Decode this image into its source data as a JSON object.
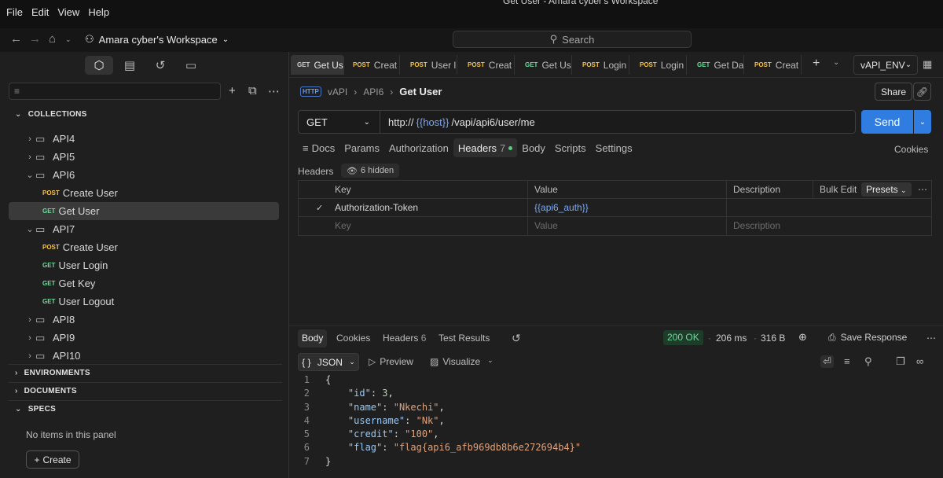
{
  "menu": [
    "File",
    "Edit",
    "View",
    "Help"
  ],
  "window_title": "Get User - Amara cyber's Workspace",
  "workspace": "Amara cyber's Workspace",
  "search_placeholder": "Search",
  "sidebar": {
    "collections_label": "COLLECTIONS",
    "folders": {
      "api4": "API4",
      "api5": "API5",
      "api6": "API6",
      "api7": "API7",
      "api8": "API8",
      "api9": "API9",
      "api10": "API10"
    },
    "api6_items": [
      {
        "method": "POST",
        "label": "Create User"
      },
      {
        "method": "GET",
        "label": "Get User"
      }
    ],
    "api7_items": [
      {
        "method": "POST",
        "label": "Create User"
      },
      {
        "method": "GET",
        "label": "User Login"
      },
      {
        "method": "GET",
        "label": "Get Key"
      },
      {
        "method": "GET",
        "label": "User Logout"
      }
    ],
    "environments_label": "ENVIRONMENTS",
    "documents_label": "DOCUMENTS",
    "specs_label": "SPECS",
    "empty_note": "No items in this panel",
    "create_label": "Create"
  },
  "tabs": [
    {
      "method": "GET",
      "label": "Get Us"
    },
    {
      "method": "POST",
      "label": "Creat"
    },
    {
      "method": "POST",
      "label": "User l"
    },
    {
      "method": "POST",
      "label": "Creat"
    },
    {
      "method": "GET",
      "label": "Get Us"
    },
    {
      "method": "POST",
      "label": "Login"
    },
    {
      "method": "POST",
      "label": "Login"
    },
    {
      "method": "GET",
      "label": "Get Da"
    },
    {
      "method": "POST",
      "label": "Creat"
    }
  ],
  "environment": "vAPI_ENV",
  "breadcrumb": {
    "icon": "HTTP",
    "root": "vAPI",
    "folder": "API6",
    "current": "Get User"
  },
  "share_label": "Share",
  "request": {
    "method": "GET",
    "url_prefix": "http://",
    "url_var": "{{host}}",
    "url_path": "/vapi/api6/user/me",
    "send_label": "Send"
  },
  "request_tabs": {
    "docs": "Docs",
    "params": "Params",
    "authorization": "Authorization",
    "headers": "Headers",
    "headers_count": "7",
    "body": "Body",
    "scripts": "Scripts",
    "settings": "Settings",
    "cookies": "Cookies"
  },
  "headers_section": {
    "label": "Headers",
    "hidden": "6 hidden",
    "col_key": "Key",
    "col_value": "Value",
    "col_description": "Description",
    "bulk_edit": "Bulk Edit",
    "presets": "Presets",
    "rows": [
      {
        "key": "Authorization-Token",
        "value": "{{api6_auth}}",
        "description": ""
      }
    ],
    "placeholder_key": "Key",
    "placeholder_value": "Value",
    "placeholder_description": "Description"
  },
  "response": {
    "tabs": {
      "body": "Body",
      "cookies": "Cookies",
      "headers": "Headers",
      "headers_count": "6",
      "test_results": "Test Results"
    },
    "status": "200 OK",
    "time": "206 ms",
    "size": "316 B",
    "save_label": "Save Response",
    "format": "JSON",
    "preview": "Preview",
    "visualize": "Visualize",
    "lines": [
      {
        "ln": "1",
        "open": "{"
      },
      {
        "ln": "2",
        "key": "\"id\"",
        "val": "3",
        "type": "n",
        "comma": ","
      },
      {
        "ln": "3",
        "key": "\"name\"",
        "val": "\"Nkechi\"",
        "type": "s",
        "comma": ","
      },
      {
        "ln": "4",
        "key": "\"username\"",
        "val": "\"Nk\"",
        "type": "s",
        "comma": ","
      },
      {
        "ln": "5",
        "key": "\"credit\"",
        "val": "\"100\"",
        "type": "s",
        "comma": ","
      },
      {
        "ln": "6",
        "key": "\"flag\"",
        "val": "\"flag{api6_afb969db8b6e272694b4}\"",
        "type": "s",
        "comma": ""
      },
      {
        "ln": "7",
        "open": "}"
      }
    ]
  },
  "colors": {
    "accent": "#2f7de1",
    "get": "#6bdd9a",
    "post": "#f3c14b",
    "status_ok": "#6bdd9a"
  }
}
